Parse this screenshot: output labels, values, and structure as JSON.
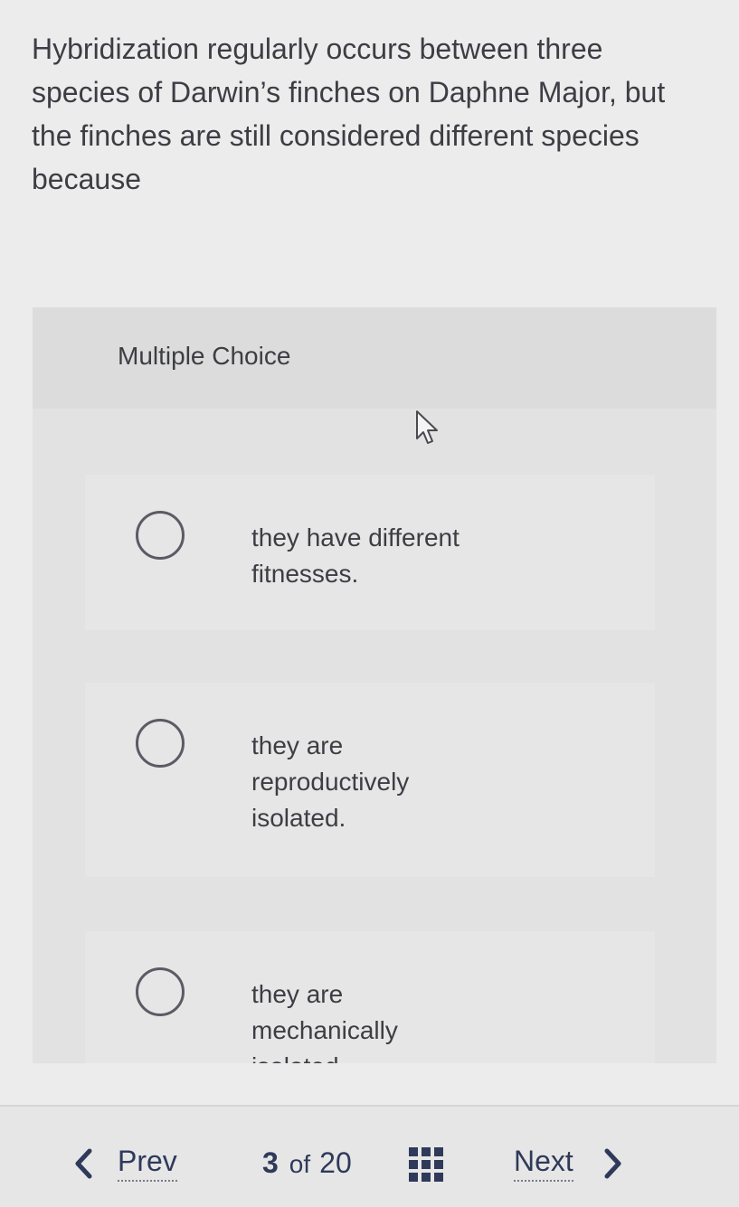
{
  "question": {
    "text": "Hybridization regularly occurs between three species of Darwin’s finches on Daphne Major, but the finches are still considered different species because"
  },
  "multiple_choice": {
    "header": "Multiple Choice",
    "choices": [
      {
        "label": "they have different fitnesses."
      },
      {
        "label": "they are reproductively isolated."
      },
      {
        "label": "they are mechanically isolated."
      }
    ]
  },
  "navigation": {
    "prev_label": "Prev",
    "current_page": "3",
    "of_label": "of",
    "total_pages": "20",
    "next_label": "Next",
    "prev_icon": "chevron-left-icon",
    "next_icon": "chevron-right-icon",
    "grid_icon": "question-grid-icon"
  },
  "colors": {
    "accent": "#2f3a5a",
    "text": "#3d3d44",
    "background": "#ececec"
  }
}
